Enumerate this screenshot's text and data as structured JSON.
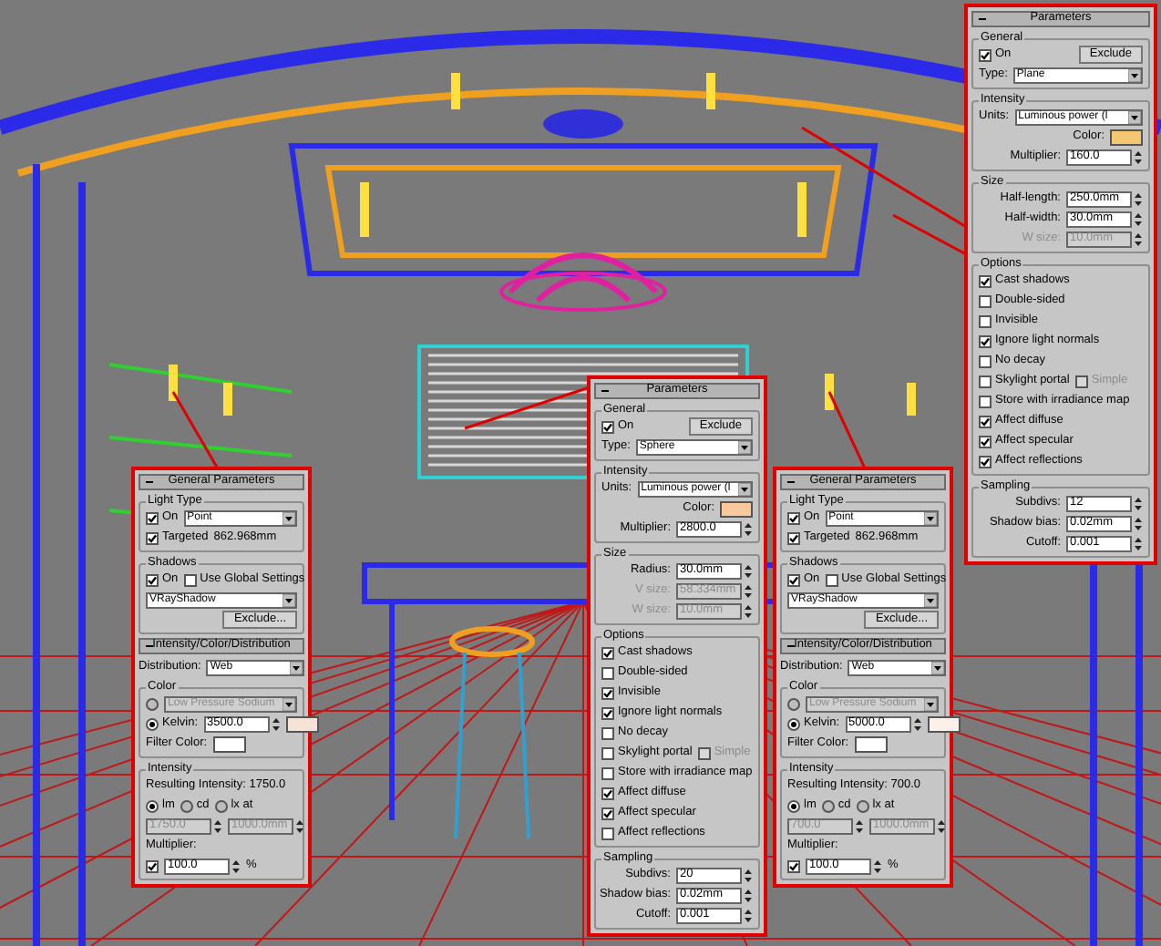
{
  "panels": [
    {
      "rollouts": [
        {
          "title": "Parameters",
          "items": [
            {
              "kind": "group",
              "title": "General",
              "rows": [
                {
                  "kind": "plain",
                  "parts": [
                    {
                      "kind": "checkbox",
                      "label": "On",
                      "checked": true
                    },
                    {
                      "kind": "button",
                      "label": "Exclude"
                    }
                  ]
                },
                {
                  "kind": "plain",
                  "parts": [
                    {
                      "kind": "label",
                      "text": "Type:"
                    },
                    {
                      "kind": "dropdown",
                      "value": "Plane"
                    }
                  ]
                }
              ]
            },
            {
              "kind": "group",
              "title": "Intensity",
              "rows": [
                {
                  "kind": "plain",
                  "parts": [
                    {
                      "kind": "label",
                      "text": "Units:"
                    },
                    {
                      "kind": "dropdown",
                      "value": "Luminous power (l"
                    }
                  ]
                },
                {
                  "kind": "field",
                  "parts": [
                    {
                      "kind": "label",
                      "text": "Color:"
                    },
                    {
                      "kind": "color",
                      "color": "#f5c672"
                    }
                  ]
                },
                {
                  "kind": "field",
                  "parts": [
                    {
                      "kind": "label",
                      "text": "Multiplier:"
                    },
                    {
                      "kind": "spinner",
                      "value": "160.0"
                    }
                  ]
                }
              ]
            },
            {
              "kind": "group",
              "title": "Size",
              "rows": [
                {
                  "kind": "field",
                  "parts": [
                    {
                      "kind": "label",
                      "text": "Half-length:"
                    },
                    {
                      "kind": "spinner",
                      "value": "250.0mm"
                    }
                  ]
                },
                {
                  "kind": "field",
                  "parts": [
                    {
                      "kind": "label",
                      "text": "Half-width:"
                    },
                    {
                      "kind": "spinner",
                      "value": "30.0mm"
                    }
                  ]
                },
                {
                  "kind": "field",
                  "parts": [
                    {
                      "kind": "label",
                      "text": "W size:",
                      "disabled": true
                    },
                    {
                      "kind": "spinner",
                      "value": "10.0mm",
                      "disabled": true
                    }
                  ]
                }
              ]
            },
            {
              "kind": "group",
              "title": "Options",
              "rows": [
                {
                  "kind": "plain",
                  "parts": [
                    {
                      "kind": "checkbox",
                      "label": "Cast shadows",
                      "checked": true
                    }
                  ]
                },
                {
                  "kind": "plain",
                  "parts": [
                    {
                      "kind": "checkbox",
                      "label": "Double-sided",
                      "checked": false
                    }
                  ]
                },
                {
                  "kind": "plain",
                  "parts": [
                    {
                      "kind": "checkbox",
                      "label": "Invisible",
                      "checked": false
                    }
                  ]
                },
                {
                  "kind": "plain",
                  "parts": [
                    {
                      "kind": "checkbox",
                      "label": "Ignore light normals",
                      "checked": true
                    }
                  ]
                },
                {
                  "kind": "plain",
                  "parts": [
                    {
                      "kind": "checkbox",
                      "label": "No decay",
                      "checked": false
                    }
                  ]
                },
                {
                  "kind": "plain",
                  "parts": [
                    {
                      "kind": "checkbox",
                      "label": "Skylight portal",
                      "checked": false
                    },
                    {
                      "kind": "checkbox",
                      "label": "Simple",
                      "checked": false,
                      "disabled": true
                    }
                  ]
                },
                {
                  "kind": "plain",
                  "parts": [
                    {
                      "kind": "checkbox",
                      "label": "Store with irradiance map",
                      "checked": false
                    }
                  ]
                },
                {
                  "kind": "plain",
                  "parts": [
                    {
                      "kind": "checkbox",
                      "label": "Affect diffuse",
                      "checked": true
                    }
                  ]
                },
                {
                  "kind": "plain",
                  "parts": [
                    {
                      "kind": "checkbox",
                      "label": "Affect specular",
                      "checked": true
                    }
                  ]
                },
                {
                  "kind": "plain",
                  "parts": [
                    {
                      "kind": "checkbox",
                      "label": "Affect reflections",
                      "checked": true
                    }
                  ]
                }
              ]
            },
            {
              "kind": "group",
              "title": "Sampling",
              "rows": [
                {
                  "kind": "field",
                  "parts": [
                    {
                      "kind": "label",
                      "text": "Subdivs:"
                    },
                    {
                      "kind": "spinner",
                      "value": "12"
                    }
                  ]
                },
                {
                  "kind": "field",
                  "parts": [
                    {
                      "kind": "label",
                      "text": "Shadow bias:"
                    },
                    {
                      "kind": "spinner",
                      "value": "0.02mm"
                    }
                  ]
                },
                {
                  "kind": "field",
                  "parts": [
                    {
                      "kind": "label",
                      "text": "Cutoff:"
                    },
                    {
                      "kind": "spinner",
                      "value": "0.001"
                    }
                  ]
                }
              ]
            }
          ]
        }
      ]
    },
    {
      "rollouts": [
        {
          "title": "Parameters",
          "items": [
            {
              "kind": "group",
              "title": "General",
              "rows": [
                {
                  "kind": "plain",
                  "parts": [
                    {
                      "kind": "checkbox",
                      "label": "On",
                      "checked": true
                    },
                    {
                      "kind": "button",
                      "label": "Exclude"
                    }
                  ]
                },
                {
                  "kind": "plain",
                  "parts": [
                    {
                      "kind": "label",
                      "text": "Type:"
                    },
                    {
                      "kind": "dropdown",
                      "value": "Sphere"
                    }
                  ]
                }
              ]
            },
            {
              "kind": "group",
              "title": "Intensity",
              "rows": [
                {
                  "kind": "plain",
                  "parts": [
                    {
                      "kind": "label",
                      "text": "Units:"
                    },
                    {
                      "kind": "dropdown",
                      "value": "Luminous power (l"
                    }
                  ]
                },
                {
                  "kind": "field",
                  "parts": [
                    {
                      "kind": "label",
                      "text": "Color:"
                    },
                    {
                      "kind": "color",
                      "color": "#f9c89c"
                    }
                  ]
                },
                {
                  "kind": "field",
                  "parts": [
                    {
                      "kind": "label",
                      "text": "Multiplier:"
                    },
                    {
                      "kind": "spinner",
                      "value": "2800.0"
                    }
                  ]
                }
              ]
            },
            {
              "kind": "group",
              "title": "Size",
              "rows": [
                {
                  "kind": "field",
                  "parts": [
                    {
                      "kind": "label",
                      "text": "Radius:"
                    },
                    {
                      "kind": "spinner",
                      "value": "30.0mm"
                    }
                  ]
                },
                {
                  "kind": "field",
                  "parts": [
                    {
                      "kind": "label",
                      "text": "V size:",
                      "disabled": true
                    },
                    {
                      "kind": "spinner",
                      "value": "58.334mm",
                      "disabled": true
                    }
                  ]
                },
                {
                  "kind": "field",
                  "parts": [
                    {
                      "kind": "label",
                      "text": "W size:",
                      "disabled": true
                    },
                    {
                      "kind": "spinner",
                      "value": "10.0mm",
                      "disabled": true
                    }
                  ]
                }
              ]
            },
            {
              "kind": "group",
              "title": "Options",
              "rows": [
                {
                  "kind": "plain",
                  "parts": [
                    {
                      "kind": "checkbox",
                      "label": "Cast shadows",
                      "checked": true
                    }
                  ]
                },
                {
                  "kind": "plain",
                  "parts": [
                    {
                      "kind": "checkbox",
                      "label": "Double-sided",
                      "checked": false
                    }
                  ]
                },
                {
                  "kind": "plain",
                  "parts": [
                    {
                      "kind": "checkbox",
                      "label": "Invisible",
                      "checked": true
                    }
                  ]
                },
                {
                  "kind": "plain",
                  "parts": [
                    {
                      "kind": "checkbox",
                      "label": "Ignore light normals",
                      "checked": true
                    }
                  ]
                },
                {
                  "kind": "plain",
                  "parts": [
                    {
                      "kind": "checkbox",
                      "label": "No decay",
                      "checked": false
                    }
                  ]
                },
                {
                  "kind": "plain",
                  "parts": [
                    {
                      "kind": "checkbox",
                      "label": "Skylight portal",
                      "checked": false
                    },
                    {
                      "kind": "checkbox",
                      "label": "Simple",
                      "checked": false,
                      "disabled": true
                    }
                  ]
                },
                {
                  "kind": "plain",
                  "parts": [
                    {
                      "kind": "checkbox",
                      "label": "Store with irradiance map",
                      "checked": false
                    }
                  ]
                },
                {
                  "kind": "plain",
                  "parts": [
                    {
                      "kind": "checkbox",
                      "label": "Affect diffuse",
                      "checked": true
                    }
                  ]
                },
                {
                  "kind": "plain",
                  "parts": [
                    {
                      "kind": "checkbox",
                      "label": "Affect specular",
                      "checked": true
                    }
                  ]
                },
                {
                  "kind": "plain",
                  "parts": [
                    {
                      "kind": "checkbox",
                      "label": "Affect reflections",
                      "checked": false
                    }
                  ]
                }
              ]
            },
            {
              "kind": "group",
              "title": "Sampling",
              "rows": [
                {
                  "kind": "field",
                  "parts": [
                    {
                      "kind": "label",
                      "text": "Subdivs:"
                    },
                    {
                      "kind": "spinner",
                      "value": "20"
                    }
                  ]
                },
                {
                  "kind": "field",
                  "parts": [
                    {
                      "kind": "label",
                      "text": "Shadow bias:"
                    },
                    {
                      "kind": "spinner",
                      "value": "0.02mm"
                    }
                  ]
                },
                {
                  "kind": "field",
                  "parts": [
                    {
                      "kind": "label",
                      "text": "Cutoff:"
                    },
                    {
                      "kind": "spinner",
                      "value": "0.001"
                    }
                  ]
                }
              ]
            }
          ]
        }
      ]
    },
    {
      "rollouts": [
        {
          "title": "General Parameters",
          "items": [
            {
              "kind": "group",
              "title": "Light Type",
              "rows": [
                {
                  "kind": "plain",
                  "parts": [
                    {
                      "kind": "checkbox",
                      "label": "On",
                      "checked": true
                    },
                    {
                      "kind": "dropdown",
                      "value": "Point"
                    }
                  ]
                },
                {
                  "kind": "plain",
                  "parts": [
                    {
                      "kind": "checkbox",
                      "label": "Targeted",
                      "checked": true
                    },
                    {
                      "kind": "text",
                      "text": "862.968mm"
                    }
                  ]
                }
              ]
            },
            {
              "kind": "group",
              "title": "Shadows",
              "rows": [
                {
                  "kind": "plain",
                  "parts": [
                    {
                      "kind": "checkbox",
                      "label": "On",
                      "checked": true
                    },
                    {
                      "kind": "checkbox",
                      "label": "Use Global Settings",
                      "checked": false
                    }
                  ]
                },
                {
                  "kind": "plain",
                  "parts": [
                    {
                      "kind": "dropdown",
                      "value": "VRayShadow"
                    }
                  ]
                },
                {
                  "kind": "field",
                  "parts": [
                    {
                      "kind": "button",
                      "label": "Exclude..."
                    }
                  ]
                }
              ]
            }
          ]
        },
        {
          "title": "Intensity/Color/Distribution",
          "items": [
            {
              "kind": "row",
              "parts": [
                {
                  "kind": "label",
                  "text": "Distribution:"
                },
                {
                  "kind": "dropdown",
                  "value": "Web"
                }
              ]
            },
            {
              "kind": "group",
              "title": "Color",
              "rows": [
                {
                  "kind": "plain",
                  "parts": [
                    {
                      "kind": "radio",
                      "selected": false
                    },
                    {
                      "kind": "dropdown",
                      "value": "Low Pressure Sodium",
                      "disabled": true
                    }
                  ]
                },
                {
                  "kind": "plain",
                  "parts": [
                    {
                      "kind": "radio",
                      "label": "Kelvin:",
                      "selected": true
                    },
                    {
                      "kind": "spinner",
                      "value": "3500.0"
                    },
                    {
                      "kind": "color",
                      "color": "#f7e2d6"
                    }
                  ]
                },
                {
                  "kind": "plain",
                  "parts": [
                    {
                      "kind": "label",
                      "text": "Filter Color:"
                    },
                    {
                      "kind": "color",
                      "color": "#ffffff"
                    }
                  ]
                }
              ]
            },
            {
              "kind": "group",
              "title": "Intensity",
              "rows": [
                {
                  "kind": "plain",
                  "parts": [
                    {
                      "kind": "text",
                      "text": "Resulting Intensity: 1750.0"
                    }
                  ]
                },
                {
                  "kind": "plain",
                  "parts": [
                    {
                      "kind": "radio",
                      "label": "lm",
                      "selected": true
                    },
                    {
                      "kind": "radio",
                      "label": "cd",
                      "selected": false
                    },
                    {
                      "kind": "radio",
                      "label": "lx at",
                      "selected": false
                    }
                  ]
                },
                {
                  "kind": "plain",
                  "parts": [
                    {
                      "kind": "spinner",
                      "value": "1750.0",
                      "disabled": true
                    },
                    {
                      "kind": "spinner",
                      "value": "1000.0mm",
                      "disabled": true
                    }
                  ]
                },
                {
                  "kind": "plain",
                  "parts": [
                    {
                      "kind": "label",
                      "text": "Multiplier:"
                    }
                  ]
                },
                {
                  "kind": "plain",
                  "parts": [
                    {
                      "kind": "checkbox",
                      "checked": true
                    },
                    {
                      "kind": "spinner",
                      "value": "100.0"
                    },
                    {
                      "kind": "text",
                      "text": "%"
                    }
                  ]
                }
              ]
            }
          ]
        }
      ]
    },
    {
      "rollouts": [
        {
          "title": "General Parameters",
          "items": [
            {
              "kind": "group",
              "title": "Light Type",
              "rows": [
                {
                  "kind": "plain",
                  "parts": [
                    {
                      "kind": "checkbox",
                      "label": "On",
                      "checked": true
                    },
                    {
                      "kind": "dropdown",
                      "value": "Point"
                    }
                  ]
                },
                {
                  "kind": "plain",
                  "parts": [
                    {
                      "kind": "checkbox",
                      "label": "Targeted",
                      "checked": true
                    },
                    {
                      "kind": "text",
                      "text": "862.968mm"
                    }
                  ]
                }
              ]
            },
            {
              "kind": "group",
              "title": "Shadows",
              "rows": [
                {
                  "kind": "plain",
                  "parts": [
                    {
                      "kind": "checkbox",
                      "label": "On",
                      "checked": true
                    },
                    {
                      "kind": "checkbox",
                      "label": "Use Global Settings",
                      "checked": false
                    }
                  ]
                },
                {
                  "kind": "plain",
                  "parts": [
                    {
                      "kind": "dropdown",
                      "value": "VRayShadow"
                    }
                  ]
                },
                {
                  "kind": "field",
                  "parts": [
                    {
                      "kind": "button",
                      "label": "Exclude..."
                    }
                  ]
                }
              ]
            }
          ]
        },
        {
          "title": "Intensity/Color/Distribution",
          "items": [
            {
              "kind": "row",
              "parts": [
                {
                  "kind": "label",
                  "text": "Distribution:"
                },
                {
                  "kind": "dropdown",
                  "value": "Web"
                }
              ]
            },
            {
              "kind": "group",
              "title": "Color",
              "rows": [
                {
                  "kind": "plain",
                  "parts": [
                    {
                      "kind": "radio",
                      "selected": false
                    },
                    {
                      "kind": "dropdown",
                      "value": "Low Pressure Sodium",
                      "disabled": true
                    }
                  ]
                },
                {
                  "kind": "plain",
                  "parts": [
                    {
                      "kind": "radio",
                      "label": "Kelvin:",
                      "selected": true
                    },
                    {
                      "kind": "spinner",
                      "value": "5000.0"
                    },
                    {
                      "kind": "color",
                      "color": "#fbf1e8"
                    }
                  ]
                },
                {
                  "kind": "plain",
                  "parts": [
                    {
                      "kind": "label",
                      "text": "Filter Color:"
                    },
                    {
                      "kind": "color",
                      "color": "#ffffff"
                    }
                  ]
                }
              ]
            },
            {
              "kind": "group",
              "title": "Intensity",
              "rows": [
                {
                  "kind": "plain",
                  "parts": [
                    {
                      "kind": "text",
                      "text": "Resulting Intensity: 700.0"
                    }
                  ]
                },
                {
                  "kind": "plain",
                  "parts": [
                    {
                      "kind": "radio",
                      "label": "lm",
                      "selected": true
                    },
                    {
                      "kind": "radio",
                      "label": "cd",
                      "selected": false
                    },
                    {
                      "kind": "radio",
                      "label": "lx at",
                      "selected": false
                    }
                  ]
                },
                {
                  "kind": "plain",
                  "parts": [
                    {
                      "kind": "spinner",
                      "value": "700.0",
                      "disabled": true
                    },
                    {
                      "kind": "spinner",
                      "value": "1000.0mm",
                      "disabled": true
                    }
                  ]
                },
                {
                  "kind": "plain",
                  "parts": [
                    {
                      "kind": "label",
                      "text": "Multiplier:"
                    }
                  ]
                },
                {
                  "kind": "plain",
                  "parts": [
                    {
                      "kind": "checkbox",
                      "checked": true
                    },
                    {
                      "kind": "spinner",
                      "value": "100.0"
                    },
                    {
                      "kind": "text",
                      "text": "%"
                    }
                  ]
                }
              ]
            }
          ]
        }
      ]
    }
  ]
}
